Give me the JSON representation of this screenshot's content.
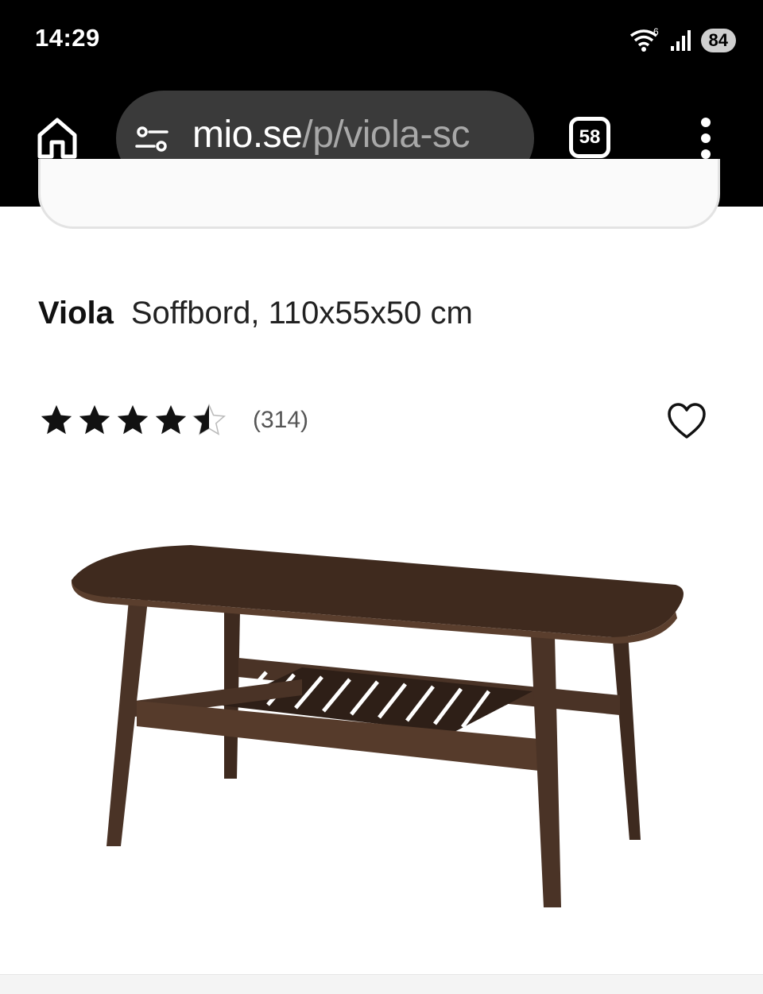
{
  "status_bar": {
    "time": "14:29",
    "wifi_badge": "6",
    "battery": "84"
  },
  "browser": {
    "url_host": "mio.se",
    "url_path": "/p/viola-sc",
    "tab_count": "58",
    "icons": [
      "home-icon",
      "tune-icon",
      "tabs-icon",
      "more-vert-icon"
    ]
  },
  "product": {
    "brand": "Viola",
    "subtitle": "Soffbord, 110x55x50 cm",
    "rating": 4.5,
    "rating_max": 5,
    "review_count": "(314)",
    "image_icon": "coffee-table-image"
  },
  "colors": {
    "toolbar_bg": "#000000",
    "omnibox_bg": "#3a3a3a",
    "wood": "#4a3326"
  }
}
